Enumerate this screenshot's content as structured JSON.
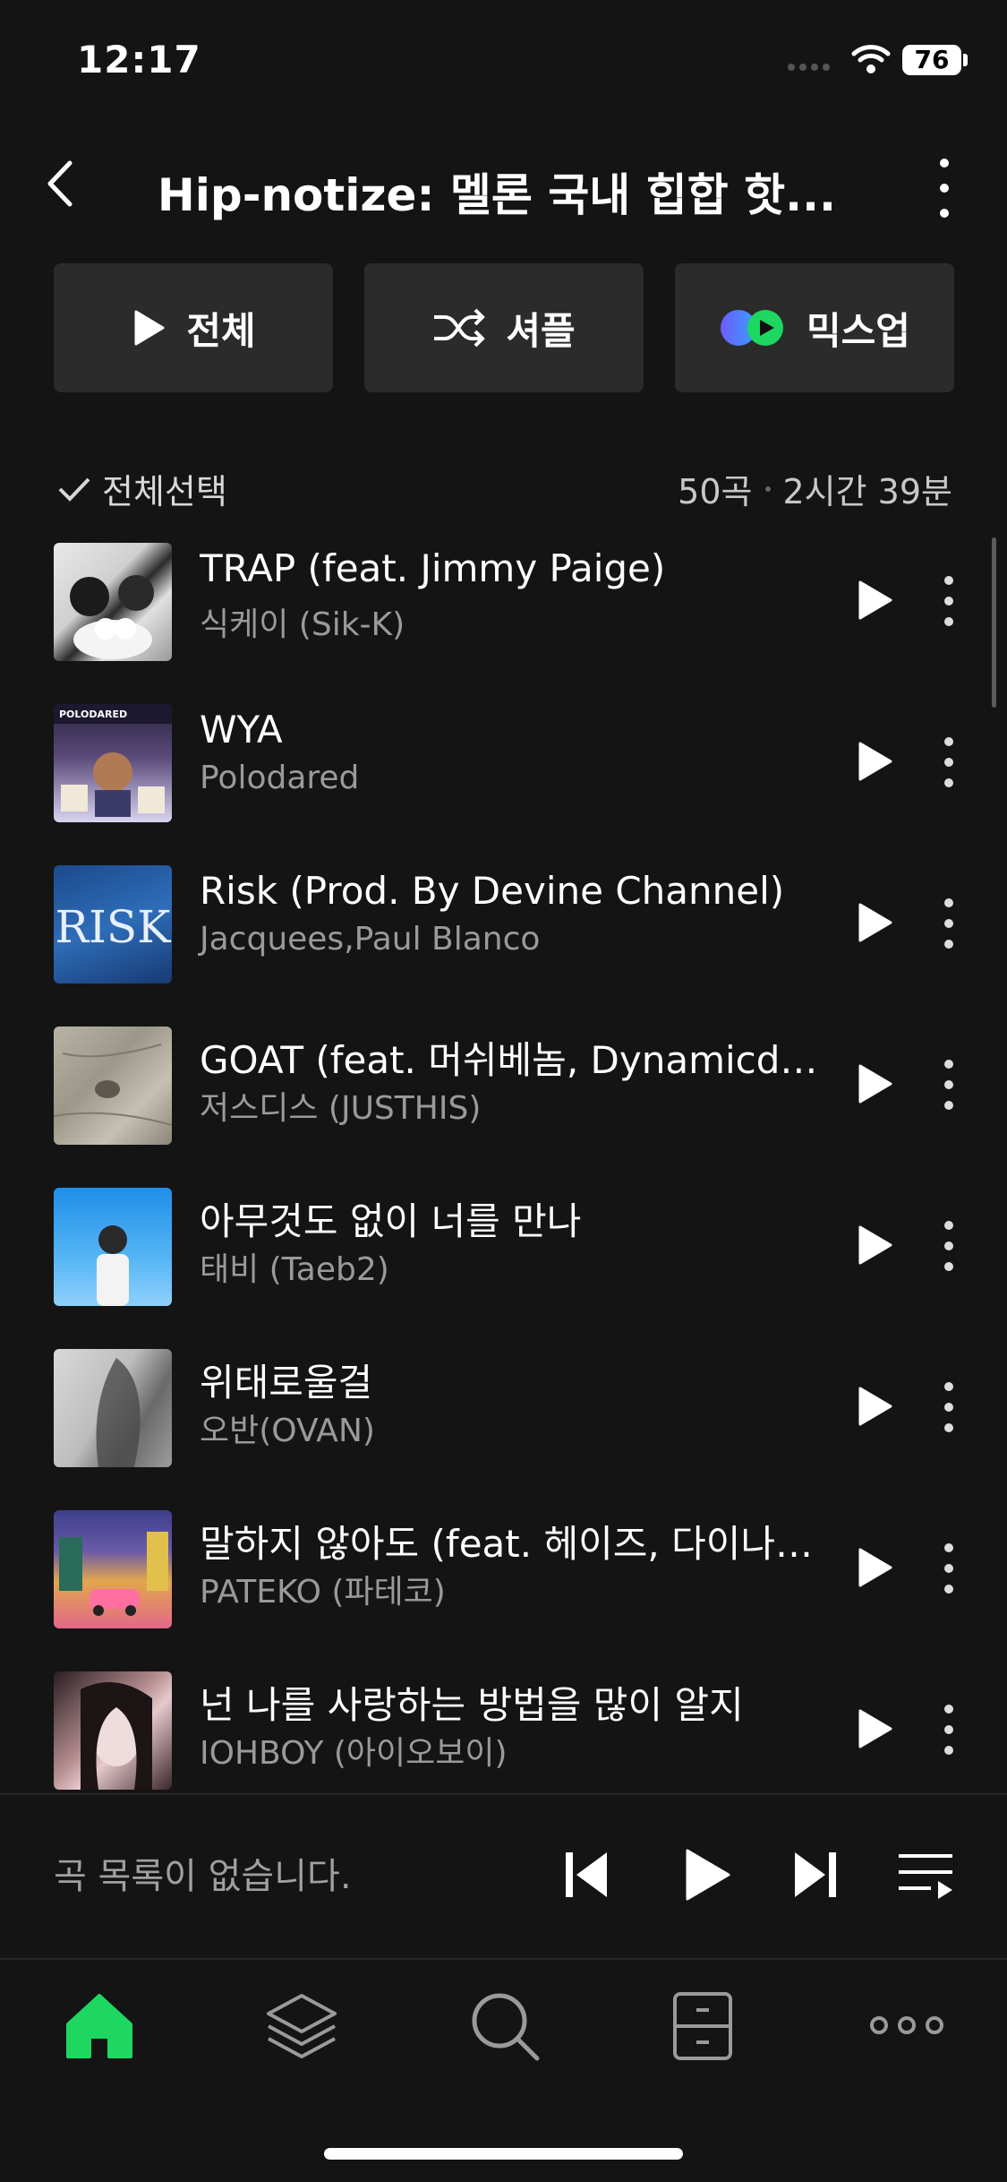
{
  "status_bar": {
    "time": "12:17",
    "battery": "76"
  },
  "header": {
    "title": "Hip-notize: 멜론 국내 힙합 핫..."
  },
  "actions": {
    "play_all": "전체",
    "shuffle": "셔플",
    "mixup": "믹스업"
  },
  "list_controls": {
    "select_all": "전체선택",
    "count": "50곡",
    "duration": "2시간 39분"
  },
  "tracks": [
    {
      "title": "TRAP (feat. Jimmy Paige)",
      "artist": "식케이 (Sik-K)"
    },
    {
      "title": "WYA",
      "artist": "Polodared",
      "art_text": "POLODARED"
    },
    {
      "title": "Risk (Prod. By Devine Channel)",
      "artist": "Jacquees,Paul Blanco",
      "art_text": "RISK"
    },
    {
      "title": "GOAT (feat. 머쉬베놈, Dynamicdu…",
      "artist": "저스디스 (JUSTHIS)"
    },
    {
      "title": "아무것도 없이 너를 만나",
      "artist": "태비 (Taeb2)"
    },
    {
      "title": "위태로울걸",
      "artist": "오반(OVAN)"
    },
    {
      "title": "말하지 않아도 (feat. 헤이즈, 다이나…",
      "artist": "PATEKO (파테코)"
    },
    {
      "title": "넌 나를 사랑하는 방법을 많이 알지",
      "artist": "IOHBOY (아이오보이)"
    }
  ],
  "mini_player": {
    "empty_text": "곡 목록이 없습니다."
  },
  "colors": {
    "accent": "#1ed760",
    "background": "#141414",
    "button_bg": "#2b2b2b"
  },
  "icons": {
    "nav": [
      "home-icon",
      "layers-icon",
      "search-icon",
      "storage-icon",
      "more-icon"
    ]
  }
}
